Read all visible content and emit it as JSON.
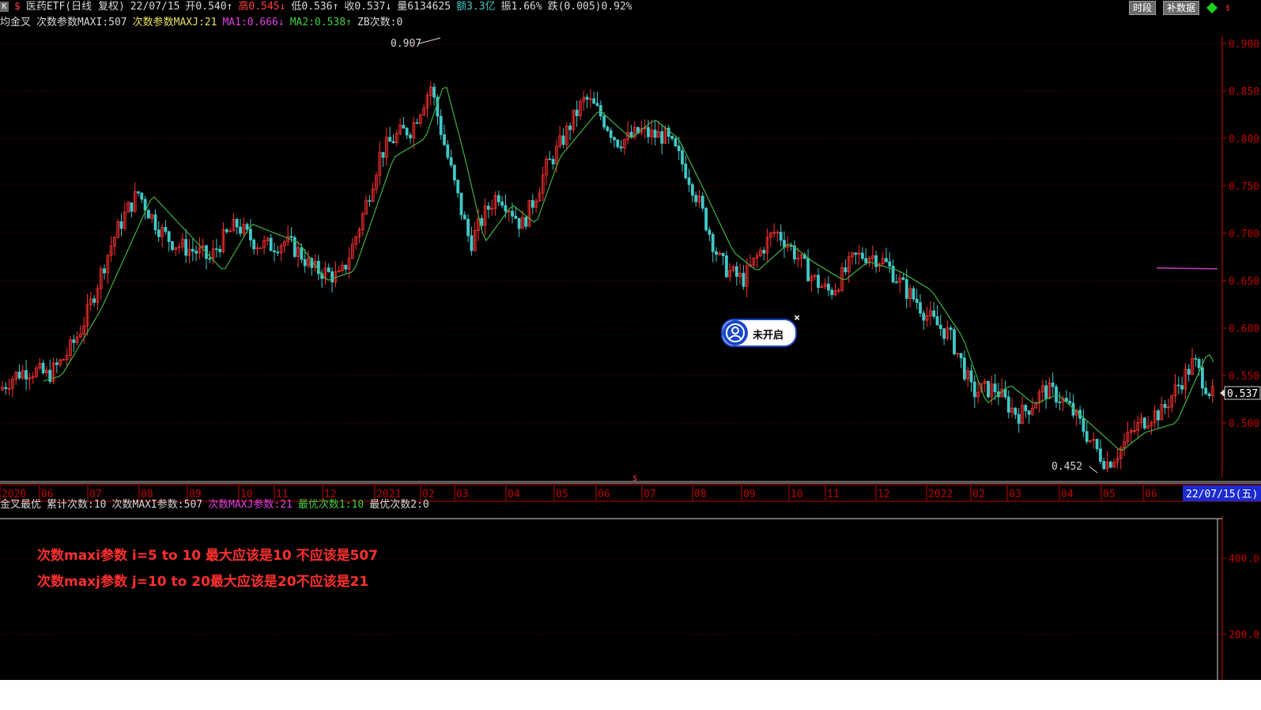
{
  "header": {
    "k_button": "K",
    "sym_marker": "$",
    "title": "医药ETF(日线 复权)",
    "date": "22/07/15",
    "open": "开0.540↑",
    "high": "高0.545↓",
    "low": "低0.536↑",
    "close": "收0.537↓",
    "volume": "量6134625",
    "amount": "额3.3亿",
    "amplitude": "振1.66%",
    "change": "跌(0.005)0.92%"
  },
  "indicator_line": {
    "name": "均金叉",
    "maxi": "次数参数MAXI:507",
    "maxj": "次数参数MAXJ:21",
    "ma1": "MA1:0.666↓",
    "ma2": "MA2:0.538↑",
    "zb": "ZB次数:0"
  },
  "toolbar": {
    "period_button": "时段",
    "supplement_button": "补数据"
  },
  "price_axis": {
    "labels": [
      "0.900",
      "0.850",
      "0.800",
      "0.750",
      "0.700",
      "0.650",
      "0.600",
      "0.550",
      "0.500"
    ],
    "current": "0.537"
  },
  "annotations": {
    "high_label": "0.907",
    "low_label": "0.452"
  },
  "time_axis": {
    "labels": [
      "2020",
      "06",
      "07",
      "08",
      "09",
      "10",
      "11",
      "12",
      "2021",
      "02",
      "03",
      "04",
      "05",
      "06",
      "07",
      "08",
      "09",
      "10",
      "11",
      "12",
      "2022",
      "02",
      "03",
      "04",
      "05",
      "06"
    ],
    "cursor_date": "22/07/15(五)"
  },
  "sub_panel": {
    "title": "金叉最优",
    "count": "累计次数:10",
    "maxi": "次数MAXI参数:507",
    "maxj": "次数MAXJ参数:21",
    "best1": "最优次数1:10",
    "best2": "最优次数2:0",
    "axis_labels": [
      "400.0",
      "200.0"
    ]
  },
  "notes": [
    "次数maxi参数  i=5 to 10 最大应该是10 不应该是507",
    "次数maxj参数  j=10 to 20最大应该是20不应该是21"
  ],
  "popup": {
    "label": "未开启",
    "close": "×"
  },
  "colors": {
    "up": "#ff3030",
    "down": "#40c8c8",
    "ma": "#40b040",
    "grid": "#8b0000",
    "axis": "#c00000"
  }
}
